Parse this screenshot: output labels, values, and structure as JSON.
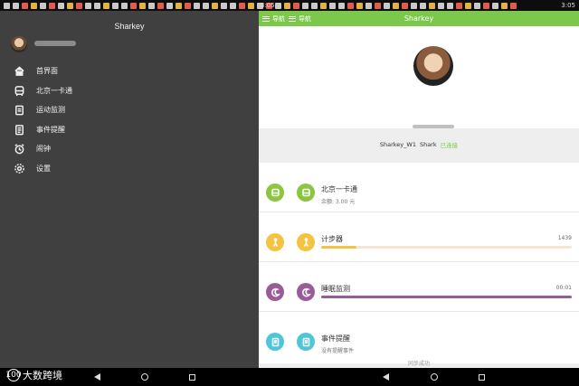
{
  "status_left": {
    "time": "3:05"
  },
  "status_right": {
    "time": "3:05"
  },
  "drawer": {
    "title": "Sharkey",
    "menu": [
      {
        "label": "首界面",
        "icon": "home-icon"
      },
      {
        "label": "北京一卡通",
        "icon": "bus-icon"
      },
      {
        "label": "运动监测",
        "icon": "clipboard-icon"
      },
      {
        "label": "事件提醒",
        "icon": "notebook-icon"
      },
      {
        "label": "闹钟",
        "icon": "alarm-clock-icon"
      },
      {
        "label": "设置",
        "icon": "gear-icon"
      }
    ]
  },
  "toolbar": {
    "nav_1": "导航",
    "nav_2": "导航",
    "title": "Sharkey"
  },
  "device": {
    "name": "Sharkey_W1",
    "owner": "Shark",
    "status": "已连接"
  },
  "cards": [
    {
      "title": "北京一卡通",
      "subtitle": "余额: 3.00 元",
      "icon": "bus-icon",
      "color": "#8cc63f"
    },
    {
      "title": "计步器",
      "value": "1439",
      "icon": "walker-icon",
      "color": "#f5c342",
      "progress": 0.14
    },
    {
      "title": "睡眠监测",
      "value": "00:01",
      "icon": "moon-icon",
      "color": "#9b5b9a",
      "progress": 1.0
    },
    {
      "title": "事件提醒",
      "subtitle": "没有提醒事件",
      "icon": "notebook-icon",
      "color": "#4fc6d8"
    }
  ],
  "sync_text": "同步成功",
  "watermark": {
    "logo": "100",
    "text": "大数跨境"
  }
}
